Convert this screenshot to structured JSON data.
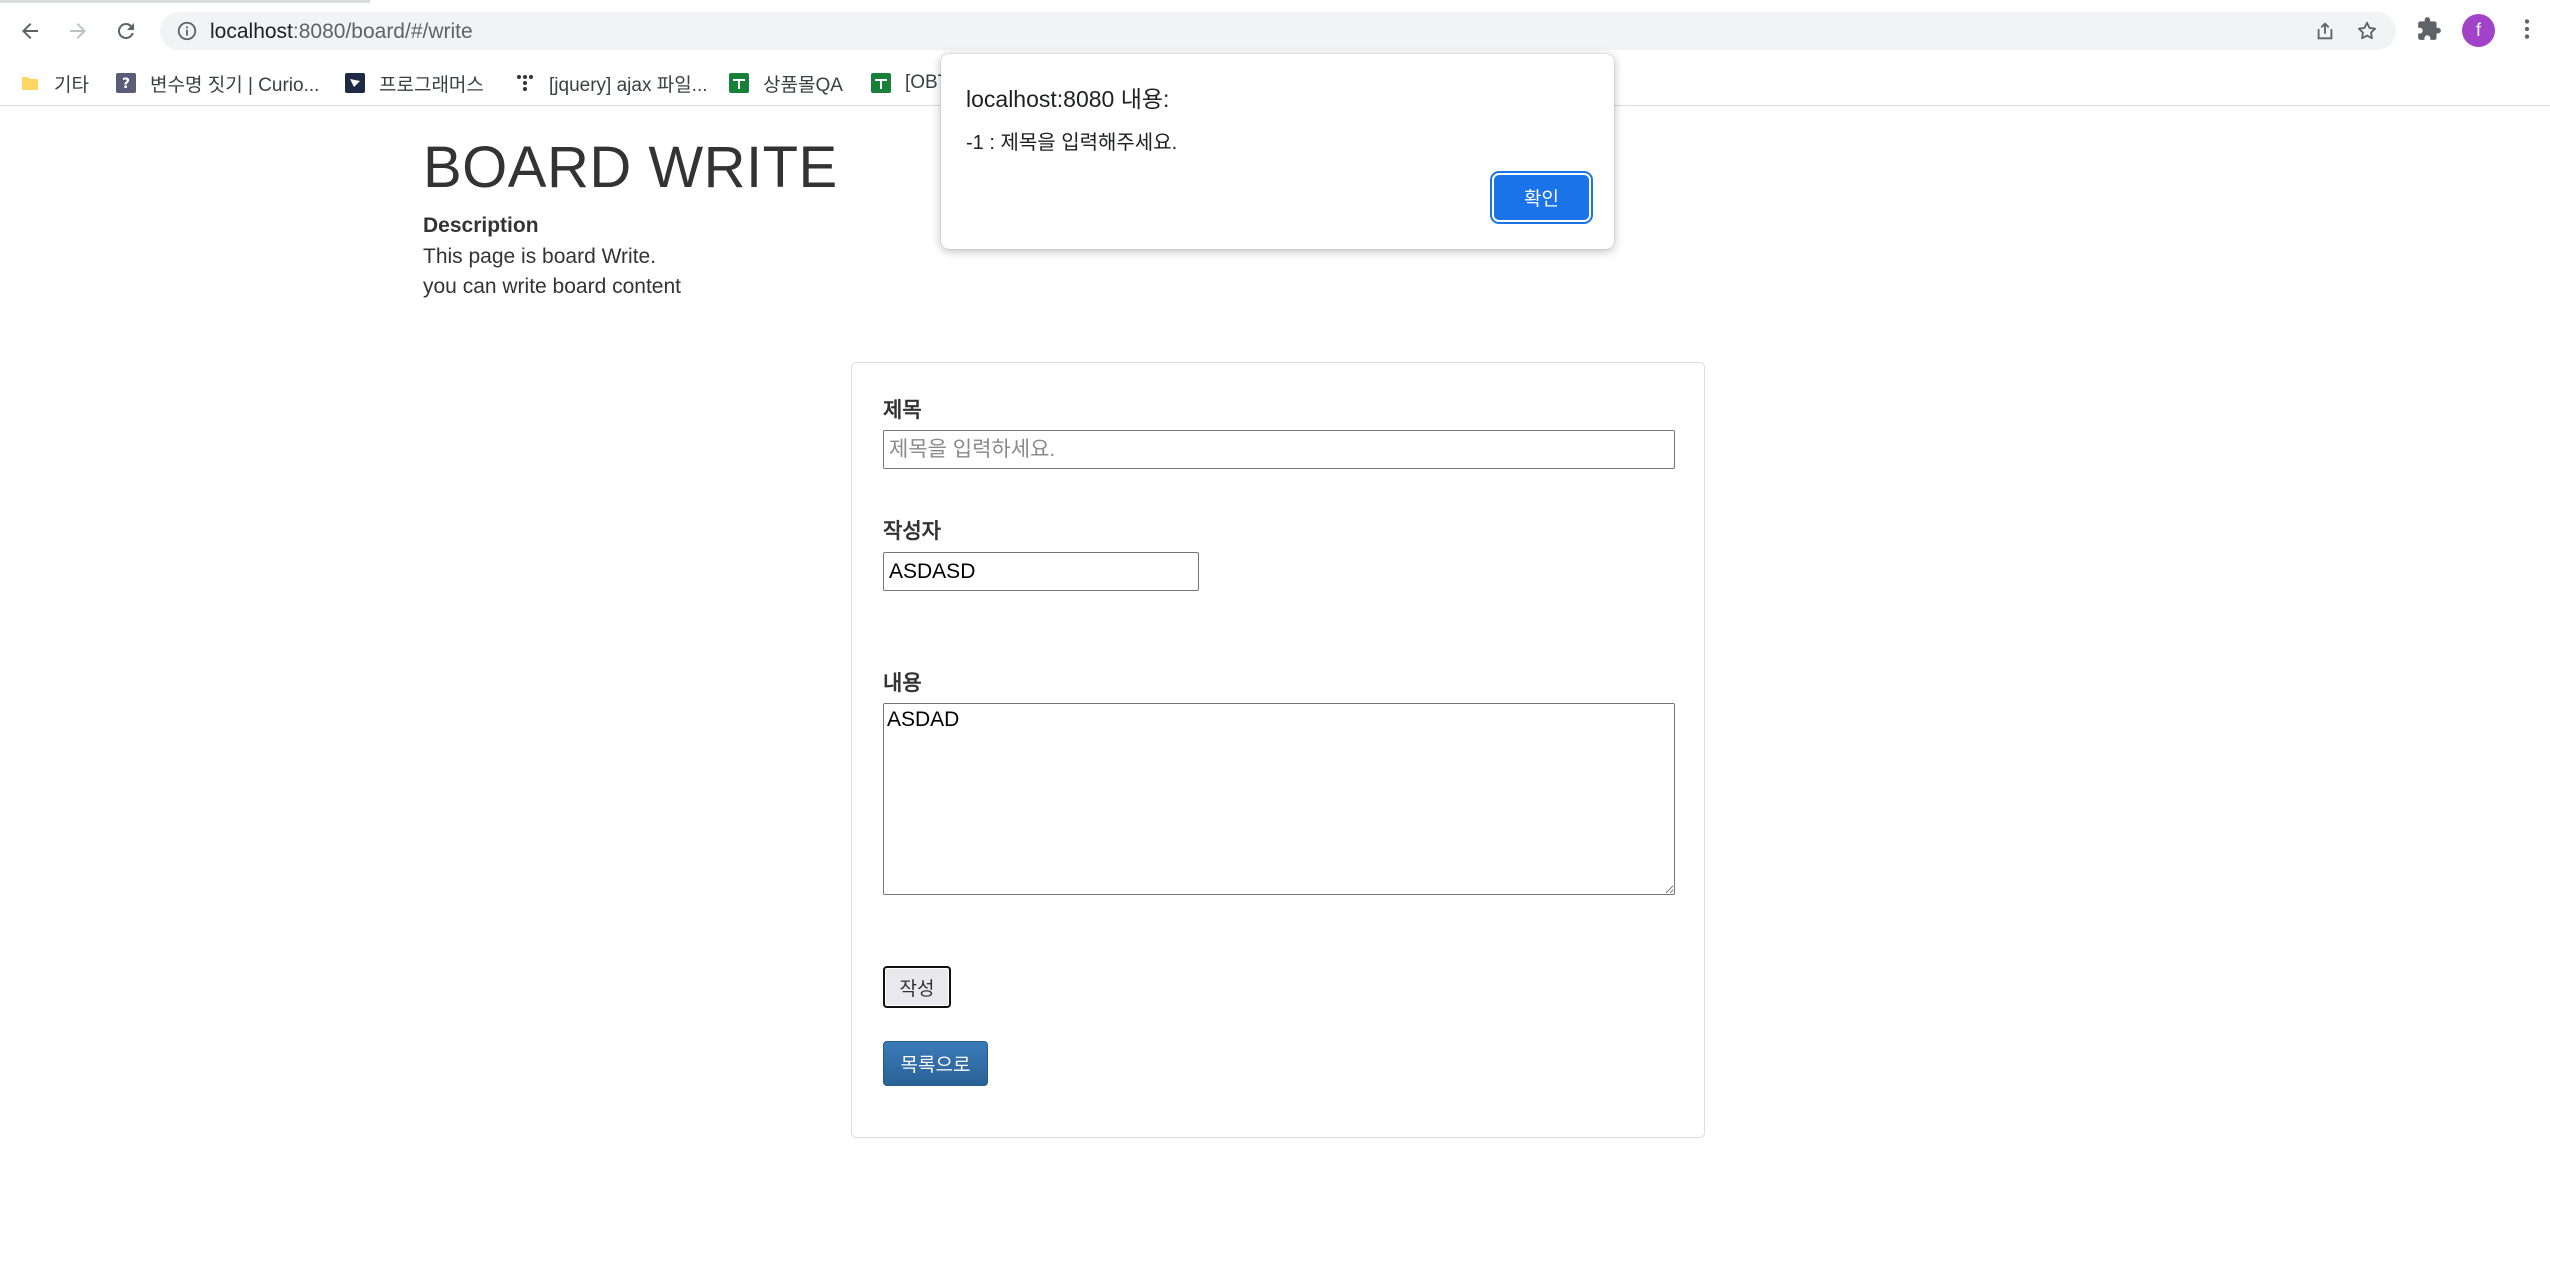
{
  "browser": {
    "url_host": "localhost",
    "url_rest": ":8080/board/#/write",
    "profile_initial": "f",
    "bookmarks": [
      {
        "label": "기타",
        "icon": "folder-icon"
      },
      {
        "label": "변수명 짓기 | Curio...",
        "icon": "question-favicon"
      },
      {
        "label": "프로그래머스",
        "icon": "programmers-favicon"
      },
      {
        "label": "[jquery] ajax 파일...",
        "icon": "tistory-favicon"
      },
      {
        "label": "상품몰QA",
        "icon": "sheets-favicon"
      },
      {
        "label": "[OBT",
        "icon": "sheets-favicon"
      }
    ]
  },
  "page": {
    "title": "BOARD WRITE",
    "description_heading": "Description",
    "description_line1": "This page is board Write.",
    "description_line2": "you can write board content"
  },
  "form": {
    "title_label": "제목",
    "title_placeholder": "제목을 입력하세요.",
    "title_value": "",
    "writer_label": "작성자",
    "writer_value": "ASDASD",
    "content_label": "내용",
    "content_value": "ASDAD",
    "submit_label": "작성",
    "list_label": "목록으로"
  },
  "dialog": {
    "title": "localhost:8080 내용:",
    "message": "-1 : 제목을 입력해주세요.",
    "ok_label": "확인"
  },
  "colors": {
    "accent_blue": "#1a73e8",
    "list_button": "#2e6da4",
    "avatar": "#a142c9"
  }
}
